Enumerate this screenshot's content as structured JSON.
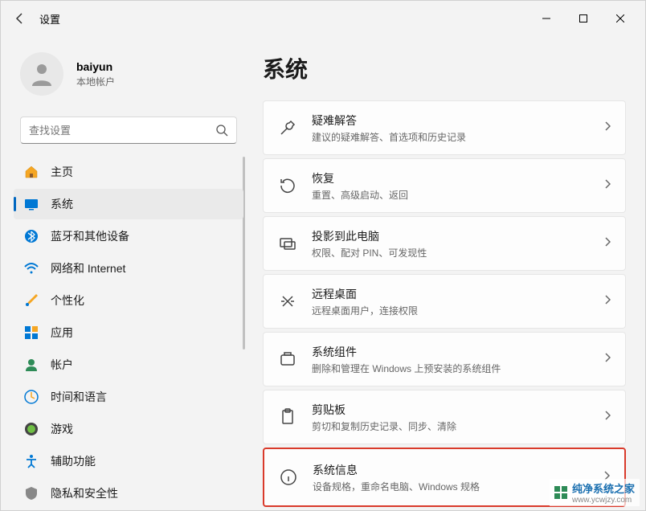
{
  "titlebar": {
    "title": "设置"
  },
  "profile": {
    "name": "baiyun",
    "sub": "本地帐户"
  },
  "search": {
    "placeholder": "查找设置"
  },
  "sidebar": {
    "items": [
      {
        "label": "主页"
      },
      {
        "label": "系统"
      },
      {
        "label": "蓝牙和其他设备"
      },
      {
        "label": "网络和 Internet"
      },
      {
        "label": "个性化"
      },
      {
        "label": "应用"
      },
      {
        "label": "帐户"
      },
      {
        "label": "时间和语言"
      },
      {
        "label": "游戏"
      },
      {
        "label": "辅助功能"
      },
      {
        "label": "隐私和安全性"
      }
    ]
  },
  "main": {
    "title": "系统",
    "cards": [
      {
        "title": "疑难解答",
        "sub": "建议的疑难解答、首选项和历史记录"
      },
      {
        "title": "恢复",
        "sub": "重置、高级启动、返回"
      },
      {
        "title": "投影到此电脑",
        "sub": "权限、配对 PIN、可发现性"
      },
      {
        "title": "远程桌面",
        "sub": "远程桌面用户，连接权限"
      },
      {
        "title": "系统组件",
        "sub": "删除和管理在 Windows 上预安装的系统组件"
      },
      {
        "title": "剪贴板",
        "sub": "剪切和复制历史记录、同步、清除"
      },
      {
        "title": "系统信息",
        "sub": "设备规格，重命名电脑、Windows 规格"
      }
    ]
  },
  "watermark": {
    "text": "纯净系统之家",
    "url": "www.ycwjzy.com"
  }
}
